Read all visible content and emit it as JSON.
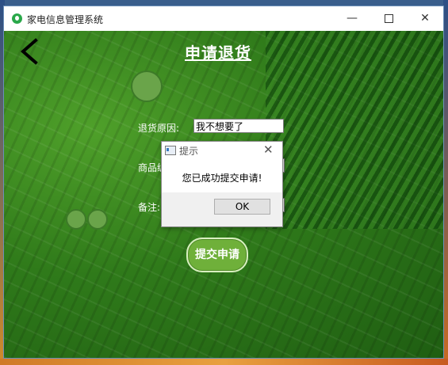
{
  "window": {
    "title": "家电信息管理系统"
  },
  "titlebar": {
    "minimize_icon": "minimize-icon",
    "maximize_icon": "maximize-icon",
    "close_icon": "close-icon"
  },
  "page": {
    "heading": "申请退货",
    "back_icon": "back-arrow-icon"
  },
  "form": {
    "reason_label": "退货原因:",
    "reason_value": "我不想要了",
    "goods_label": "商品编",
    "note_label": "备注:",
    "submit_label": "提交申请"
  },
  "dialog": {
    "title": "提示",
    "message": "您已成功提交申请!",
    "ok_label": "OK",
    "close_icon": "close-icon"
  },
  "colors": {
    "background_green": "#2f7a1a",
    "submit_button": "#6fb03a"
  }
}
